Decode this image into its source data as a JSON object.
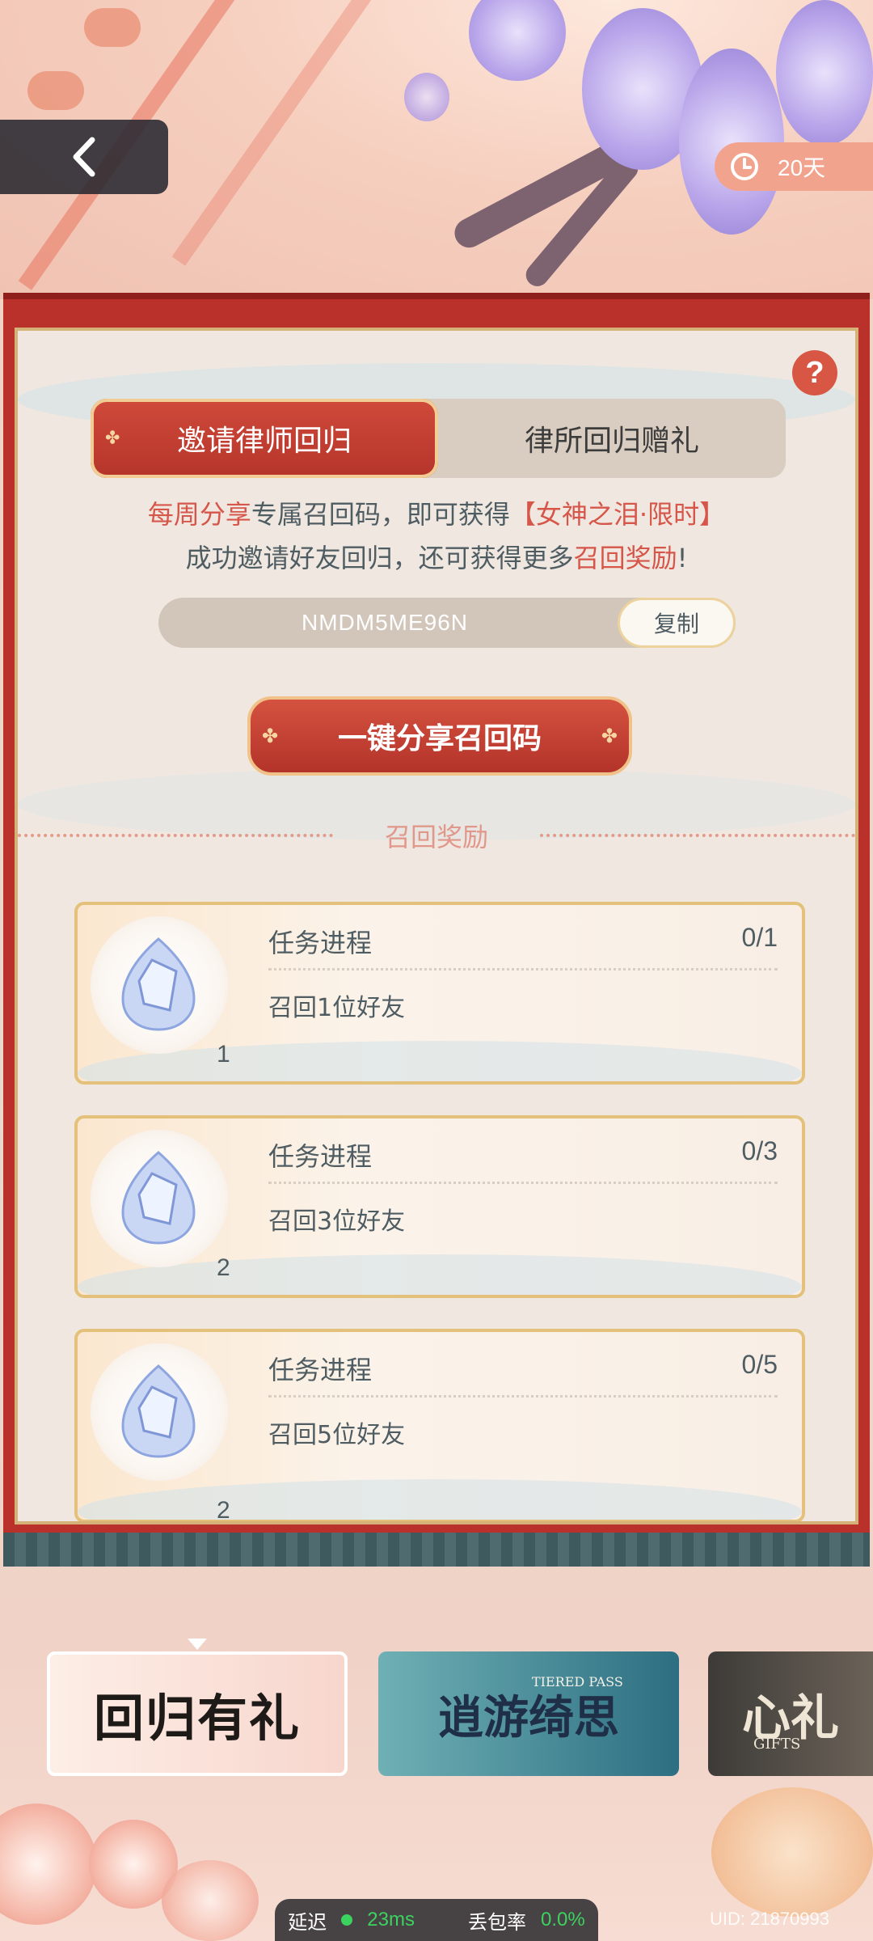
{
  "header": {
    "back_icon": "chevron-left-icon",
    "timer_icon": "clock-icon",
    "timer_text": "20天"
  },
  "panel": {
    "help_label": "?",
    "tabs": [
      {
        "label": "邀请律师回归",
        "active": true
      },
      {
        "label": "律所回归赠礼",
        "active": false
      }
    ],
    "info_line1": {
      "part1": "每周分享",
      "part2": "专属召回码，即可获得",
      "part3": "【女神之泪·限时】"
    },
    "info_line2": {
      "part1": "成功邀请好友回归，还可获得更多",
      "part2": "召回奖励",
      "part3": "!"
    },
    "code": {
      "value": "NMDM5ME96N",
      "copy_label": "复制"
    },
    "share_button": "一键分享召回码",
    "section_title": "召回奖励",
    "rewards": [
      {
        "title": "任务进程",
        "progress": "0/1",
        "desc": "召回1位好友",
        "qty": "1",
        "icon": "goddess-tear-gem-icon"
      },
      {
        "title": "任务进程",
        "progress": "0/3",
        "desc": "召回3位好友",
        "qty": "2",
        "icon": "goddess-tear-gem-icon"
      },
      {
        "title": "任务进程",
        "progress": "0/5",
        "desc": "召回5位好友",
        "qty": "2",
        "icon": "goddess-tear-gem-icon"
      }
    ]
  },
  "carousel": {
    "cards": [
      {
        "title": "回归有礼",
        "selected": true
      },
      {
        "title": "逍游绮思",
        "subtitle": "TIERED PASS"
      },
      {
        "title": "心礼",
        "subtitle": "GIFTS"
      }
    ]
  },
  "status": {
    "latency_label": "延迟",
    "latency_value": "23ms",
    "loss_label": "丢包率",
    "loss_value": "0.0%",
    "uid": "UID: 21870993"
  },
  "colors": {
    "accent_red": "#b9312a",
    "gold_border": "#d5b277",
    "text": "#4f5d63",
    "highlight": "#d6564a"
  }
}
